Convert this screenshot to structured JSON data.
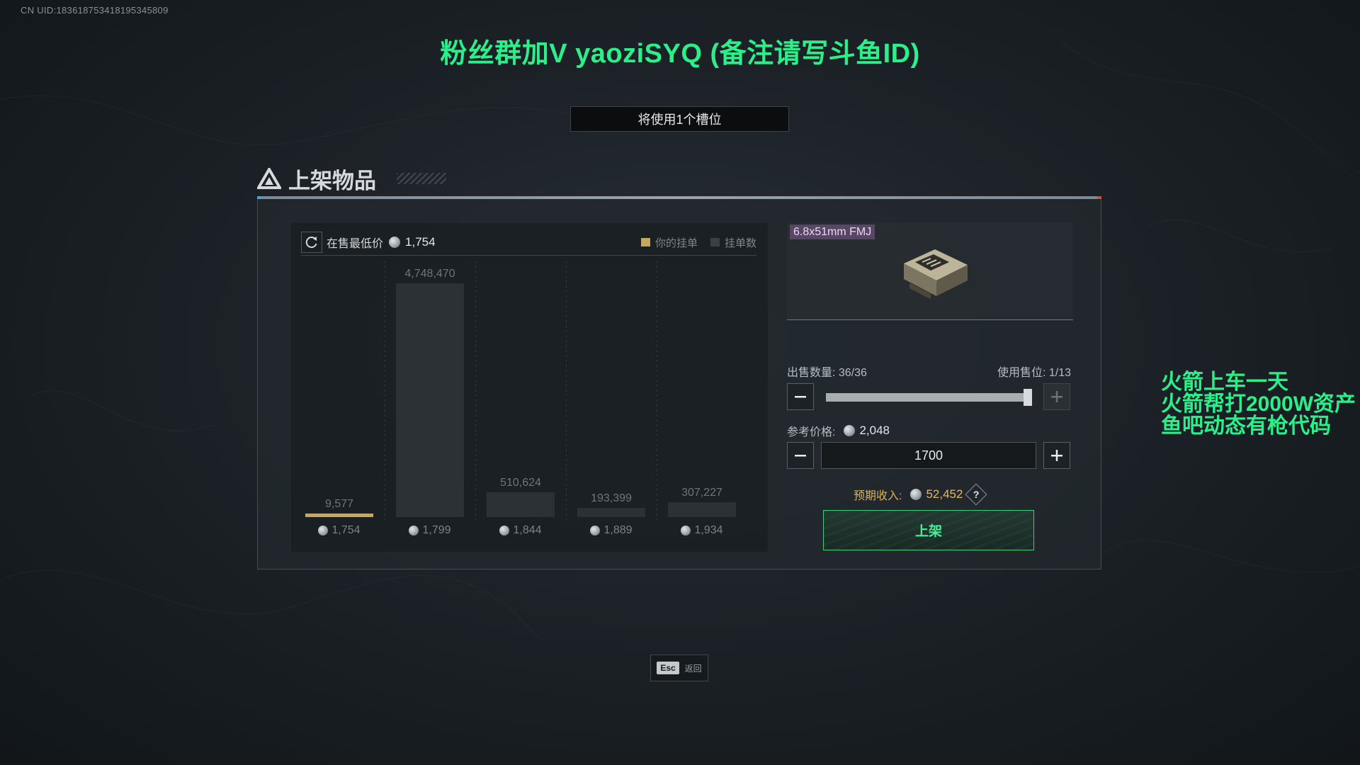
{
  "uid_text": "CN UID:183618753418195345809",
  "overlay": {
    "title": "粉丝群加V yaoziSYQ (备注请写斗鱼ID)",
    "side_notes": [
      "火箭上车一天",
      "火箭帮打2000W资产",
      "鱼吧动态有枪代码"
    ]
  },
  "slot_info": "将使用1个槽位",
  "panel": {
    "title": "上架物品",
    "title_icon": "triangle-logo-icon"
  },
  "market": {
    "lowest_label": "在售最低价",
    "lowest_price": "1,754",
    "legend": [
      {
        "label": "你的挂单",
        "color": "#c9a85a"
      },
      {
        "label": "挂单数",
        "color": "#3a4146"
      }
    ]
  },
  "chart_data": {
    "type": "bar",
    "title": "",
    "categories": [
      "1,754",
      "1,799",
      "1,844",
      "1,889",
      "1,934"
    ],
    "series": [
      {
        "values": [
          9577,
          4748470,
          510624,
          193399,
          307227
        ]
      }
    ],
    "value_labels": [
      "9,577",
      "4,748,470",
      "510,624",
      "193,399",
      "307,227"
    ],
    "highlight_index": 0
  },
  "item": {
    "name": "6.8x51mm FMJ"
  },
  "sell": {
    "qty_label": "出售数量: 36/36",
    "slot_label": "使用售位: 1/13",
    "qty_fraction": 1.0,
    "ref_label": "参考价格:",
    "ref_price": "2,048",
    "price_value": "1700",
    "income_label": "预期收入:",
    "income_value": "52,452",
    "help_label": "?",
    "list_button": "上架"
  },
  "footer": {
    "esc_key": "Esc",
    "esc_label": "返回"
  }
}
